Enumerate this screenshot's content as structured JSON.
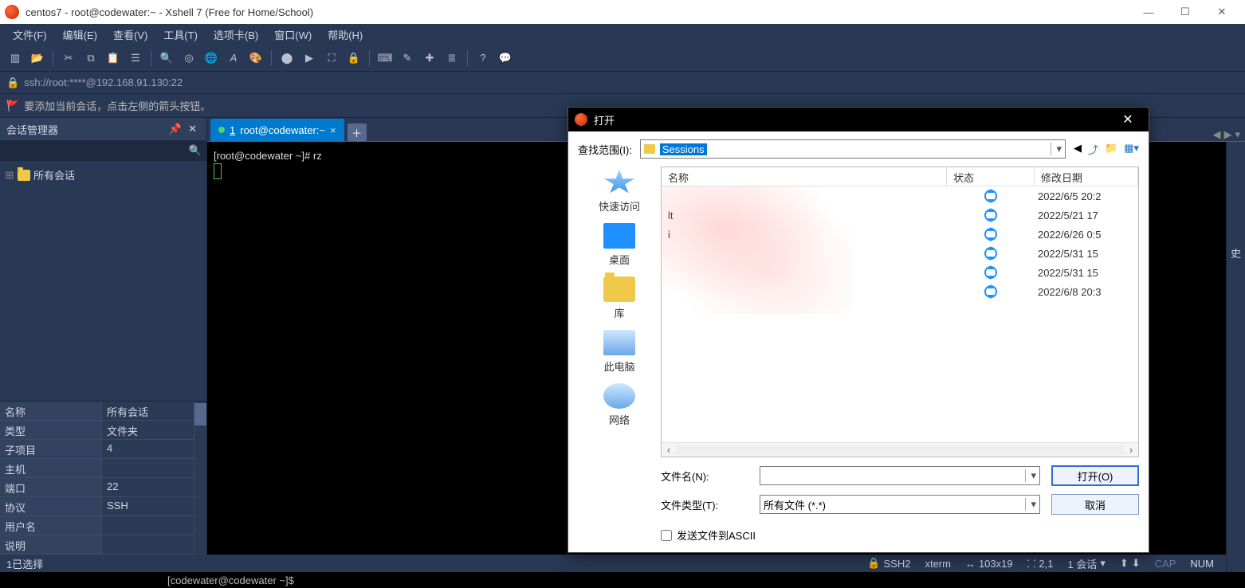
{
  "window": {
    "title": "centos7 - root@codewater:~ - Xshell 7 (Free for Home/School)"
  },
  "menu": [
    "文件(F)",
    "编辑(E)",
    "查看(V)",
    "工具(T)",
    "选项卡(B)",
    "窗口(W)",
    "帮助(H)"
  ],
  "address": "ssh://root:****@192.168.91.130:22",
  "hint": "要添加当前会话，点击左侧的箭头按钮。",
  "session_manager": {
    "title": "会话管理器",
    "root_label": "所有会话"
  },
  "props": [
    {
      "k": "名称",
      "v": "所有会话"
    },
    {
      "k": "类型",
      "v": "文件夹"
    },
    {
      "k": "子项目",
      "v": "4"
    },
    {
      "k": "主机",
      "v": ""
    },
    {
      "k": "端口",
      "v": "22"
    },
    {
      "k": "协议",
      "v": "SSH"
    },
    {
      "k": "用户名",
      "v": ""
    },
    {
      "k": "说明",
      "v": ""
    }
  ],
  "tabs": [
    {
      "index": "1",
      "label": "root@codewater:~"
    }
  ],
  "terminal": {
    "prompt": "[root@codewater ~]# ",
    "cmd": "rz"
  },
  "status": {
    "left": "1已选择",
    "ssh": "SSH2",
    "term": "xterm",
    "size": "103x19",
    "pos": "2,1",
    "sessions": "1 会话",
    "cap": "CAP",
    "num": "NUM"
  },
  "lower": "[codewater@codewater ~]$",
  "history_stub": "史",
  "dialog": {
    "title": "打开",
    "lookin_label": "查找范围(I):",
    "lookin_value": "Sessions",
    "columns": {
      "name": "名称",
      "state": "状态",
      "date": "修改日期"
    },
    "rows": [
      {
        "name": "",
        "date": "2022/6/5 20:2"
      },
      {
        "name": "lt",
        "date": "2022/5/21 17"
      },
      {
        "name": "i",
        "date": "2022/6/26 0:5"
      },
      {
        "name": "",
        "date": "2022/5/31 15"
      },
      {
        "name": "",
        "date": "2022/5/31 15"
      },
      {
        "name": "",
        "date": "2022/6/8 20:3"
      }
    ],
    "places": {
      "quick": "快速访问",
      "desktop": "桌面",
      "lib": "库",
      "pc": "此电脑",
      "net": "网络"
    },
    "filename_label": "文件名(N):",
    "filetype_label": "文件类型(T):",
    "filetype_value": "所有文件 (*.*)",
    "open_btn": "打开(O)",
    "cancel_btn": "取消",
    "ascii_chk": "发送文件到ASCII"
  }
}
